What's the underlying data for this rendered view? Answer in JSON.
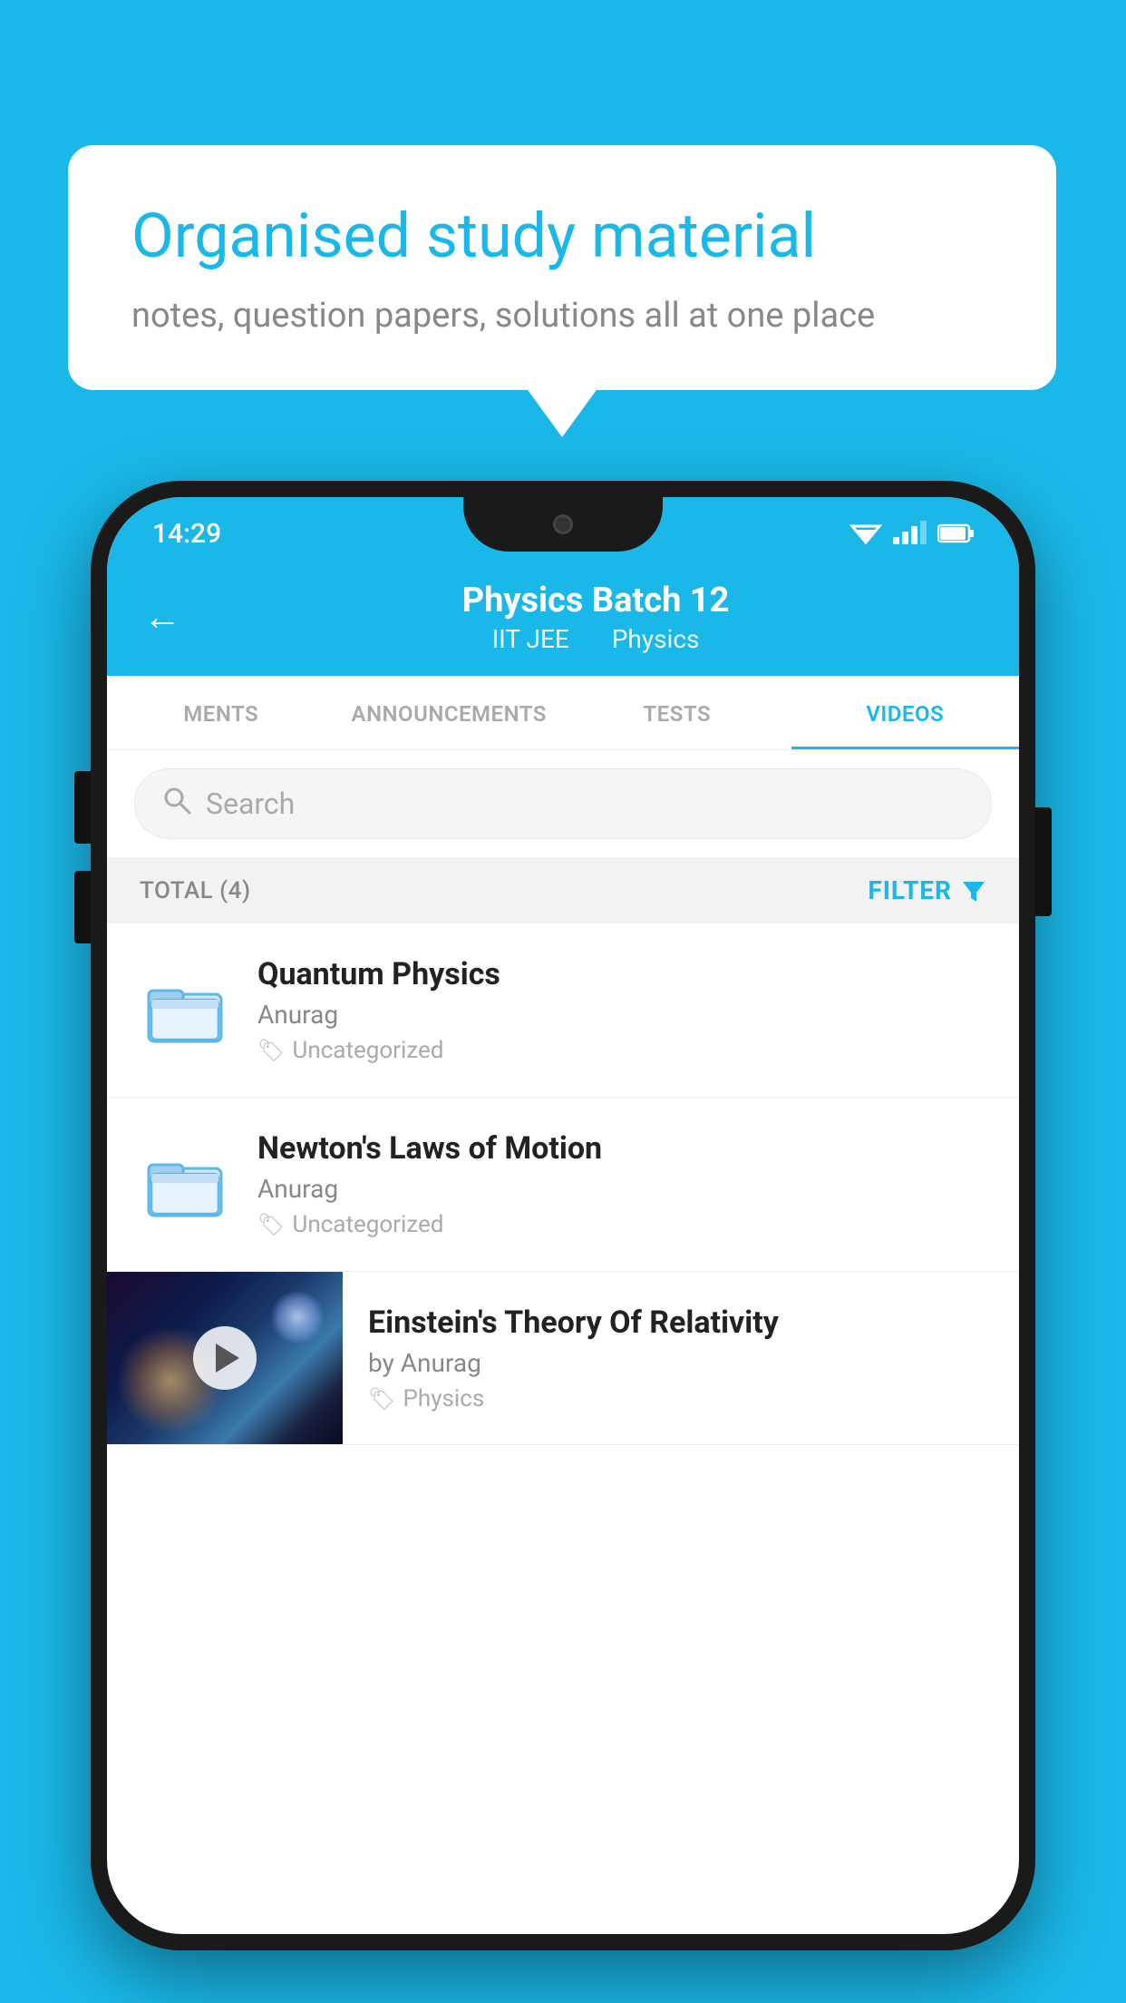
{
  "background_color": "#1ab8e8",
  "speech_bubble": {
    "title": "Organised study material",
    "subtitle": "notes, question papers, solutions all at one place"
  },
  "phone": {
    "status_bar": {
      "time": "14:29",
      "wifi": "▼▲",
      "battery": "▐"
    },
    "header": {
      "back_label": "←",
      "title": "Physics Batch 12",
      "subtitle_left": "IIT JEE",
      "subtitle_right": "Physics"
    },
    "tabs": [
      {
        "label": "MENTS",
        "active": false
      },
      {
        "label": "ANNOUNCEMENTS",
        "active": false
      },
      {
        "label": "TESTS",
        "active": false
      },
      {
        "label": "VIDEOS",
        "active": true
      }
    ],
    "search": {
      "placeholder": "Search"
    },
    "filter": {
      "total_label": "TOTAL (4)",
      "filter_label": "FILTER"
    },
    "video_items": [
      {
        "id": "quantum",
        "title": "Quantum Physics",
        "author": "Anurag",
        "tag": "Uncategorized",
        "has_thumb": false
      },
      {
        "id": "newton",
        "title": "Newton's Laws of Motion",
        "author": "Anurag",
        "tag": "Uncategorized",
        "has_thumb": false
      },
      {
        "id": "einstein",
        "title": "Einstein's Theory Of Relativity",
        "author": "by Anurag",
        "tag": "Physics",
        "has_thumb": true
      }
    ]
  }
}
